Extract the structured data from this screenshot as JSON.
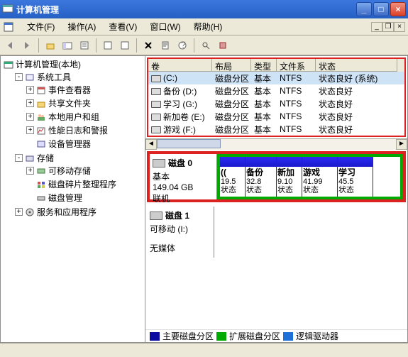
{
  "title": "计算机管理",
  "menu": {
    "file": "文件(F)",
    "action": "操作(A)",
    "view": "查看(V)",
    "window": "窗口(W)",
    "help": "帮助(H)"
  },
  "tree": {
    "root": "计算机管理(本地)",
    "systools": "系统工具",
    "eventviewer": "事件查看器",
    "shared": "共享文件夹",
    "users": "本地用户和组",
    "perf": "性能日志和警报",
    "devmgr": "设备管理器",
    "storage": "存储",
    "removable": "可移动存储",
    "defrag": "磁盘碎片整理程序",
    "diskmgmt": "磁盘管理",
    "services": "服务和应用程序"
  },
  "cols": {
    "vol": "卷",
    "layout": "布局",
    "type": "类型",
    "fs": "文件系统",
    "status": "状态"
  },
  "vols": [
    {
      "name": "(C:)",
      "layout": "磁盘分区",
      "type": "基本",
      "fs": "NTFS",
      "status": "状态良好 (系统)"
    },
    {
      "name": "备份 (D:)",
      "layout": "磁盘分区",
      "type": "基本",
      "fs": "NTFS",
      "status": "状态良好"
    },
    {
      "name": "学习 (G:)",
      "layout": "磁盘分区",
      "type": "基本",
      "fs": "NTFS",
      "status": "状态良好"
    },
    {
      "name": "新加卷 (E:)",
      "layout": "磁盘分区",
      "type": "基本",
      "fs": "NTFS",
      "status": "状态良好"
    },
    {
      "name": "游戏 (F:)",
      "layout": "磁盘分区",
      "type": "基本",
      "fs": "NTFS",
      "status": "状态良好"
    }
  ],
  "disk0": {
    "title": "磁盘 0",
    "kind": "基本",
    "size": "149.04 GB",
    "state": "联机",
    "parts": [
      {
        "name": "((",
        "size": "19.5",
        "st": "状态"
      },
      {
        "name": "备份",
        "size": "32.8",
        "st": "状态"
      },
      {
        "name": "新加",
        "size": "9.10",
        "st": "状态"
      },
      {
        "name": "游戏",
        "size": "41.99",
        "st": "状态"
      },
      {
        "name": "学习",
        "size": "45.5",
        "st": "状态"
      }
    ]
  },
  "disk1": {
    "title": "磁盘 1",
    "kind": "可移动 (I:)",
    "state": "无媒体"
  },
  "legend": {
    "primary": "主要磁盘分区",
    "extended": "扩展磁盘分区",
    "logical": "逻辑驱动器"
  }
}
